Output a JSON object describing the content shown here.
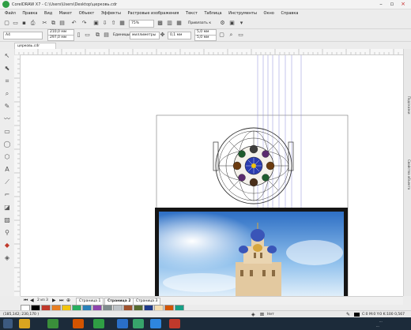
{
  "window": {
    "title": "CorelDRAW X7 - C:\\Users\\Users\\Desktop\\церковь.cdr"
  },
  "menu": [
    "Файл",
    "Правка",
    "Вид",
    "Макет",
    "Объект",
    "Эффекты",
    "Растровые изображения",
    "Текст",
    "Таблица",
    "Инструменты",
    "Окно",
    "Справка"
  ],
  "toolbar": {
    "zoom": "75%",
    "snap": "Привязать к",
    "page_size": "A4",
    "width": "210,0 мм",
    "height": "297,0 мм",
    "units_label": "Единицы:",
    "units": "миллиметры",
    "nudge": "0,1 мм",
    "dup_x": "5,0 мм",
    "dup_y": "5,0 мм"
  },
  "document": {
    "tab": "церковь.cdr"
  },
  "pages": {
    "counter": "2 из 3",
    "tabs": [
      "Страница 1",
      "Страница 2",
      "Страница 3"
    ],
    "active_index": 1
  },
  "docker_labels": [
    "Подсказки",
    "Свойства объекта"
  ],
  "status": {
    "coords": "(185,142; 230,170 )",
    "fill": "Нет",
    "color_info": "C:0 M:0 Y:0 K:100  0,567 п..."
  },
  "taskbar": {
    "time": "...",
    "date": "..."
  },
  "colors": {
    "accent": "#2f9e44",
    "taskbar": "#1c2b3a",
    "canvas": "#ffffff",
    "sky": "#4d8fd8",
    "gold": "#d7a63c"
  }
}
